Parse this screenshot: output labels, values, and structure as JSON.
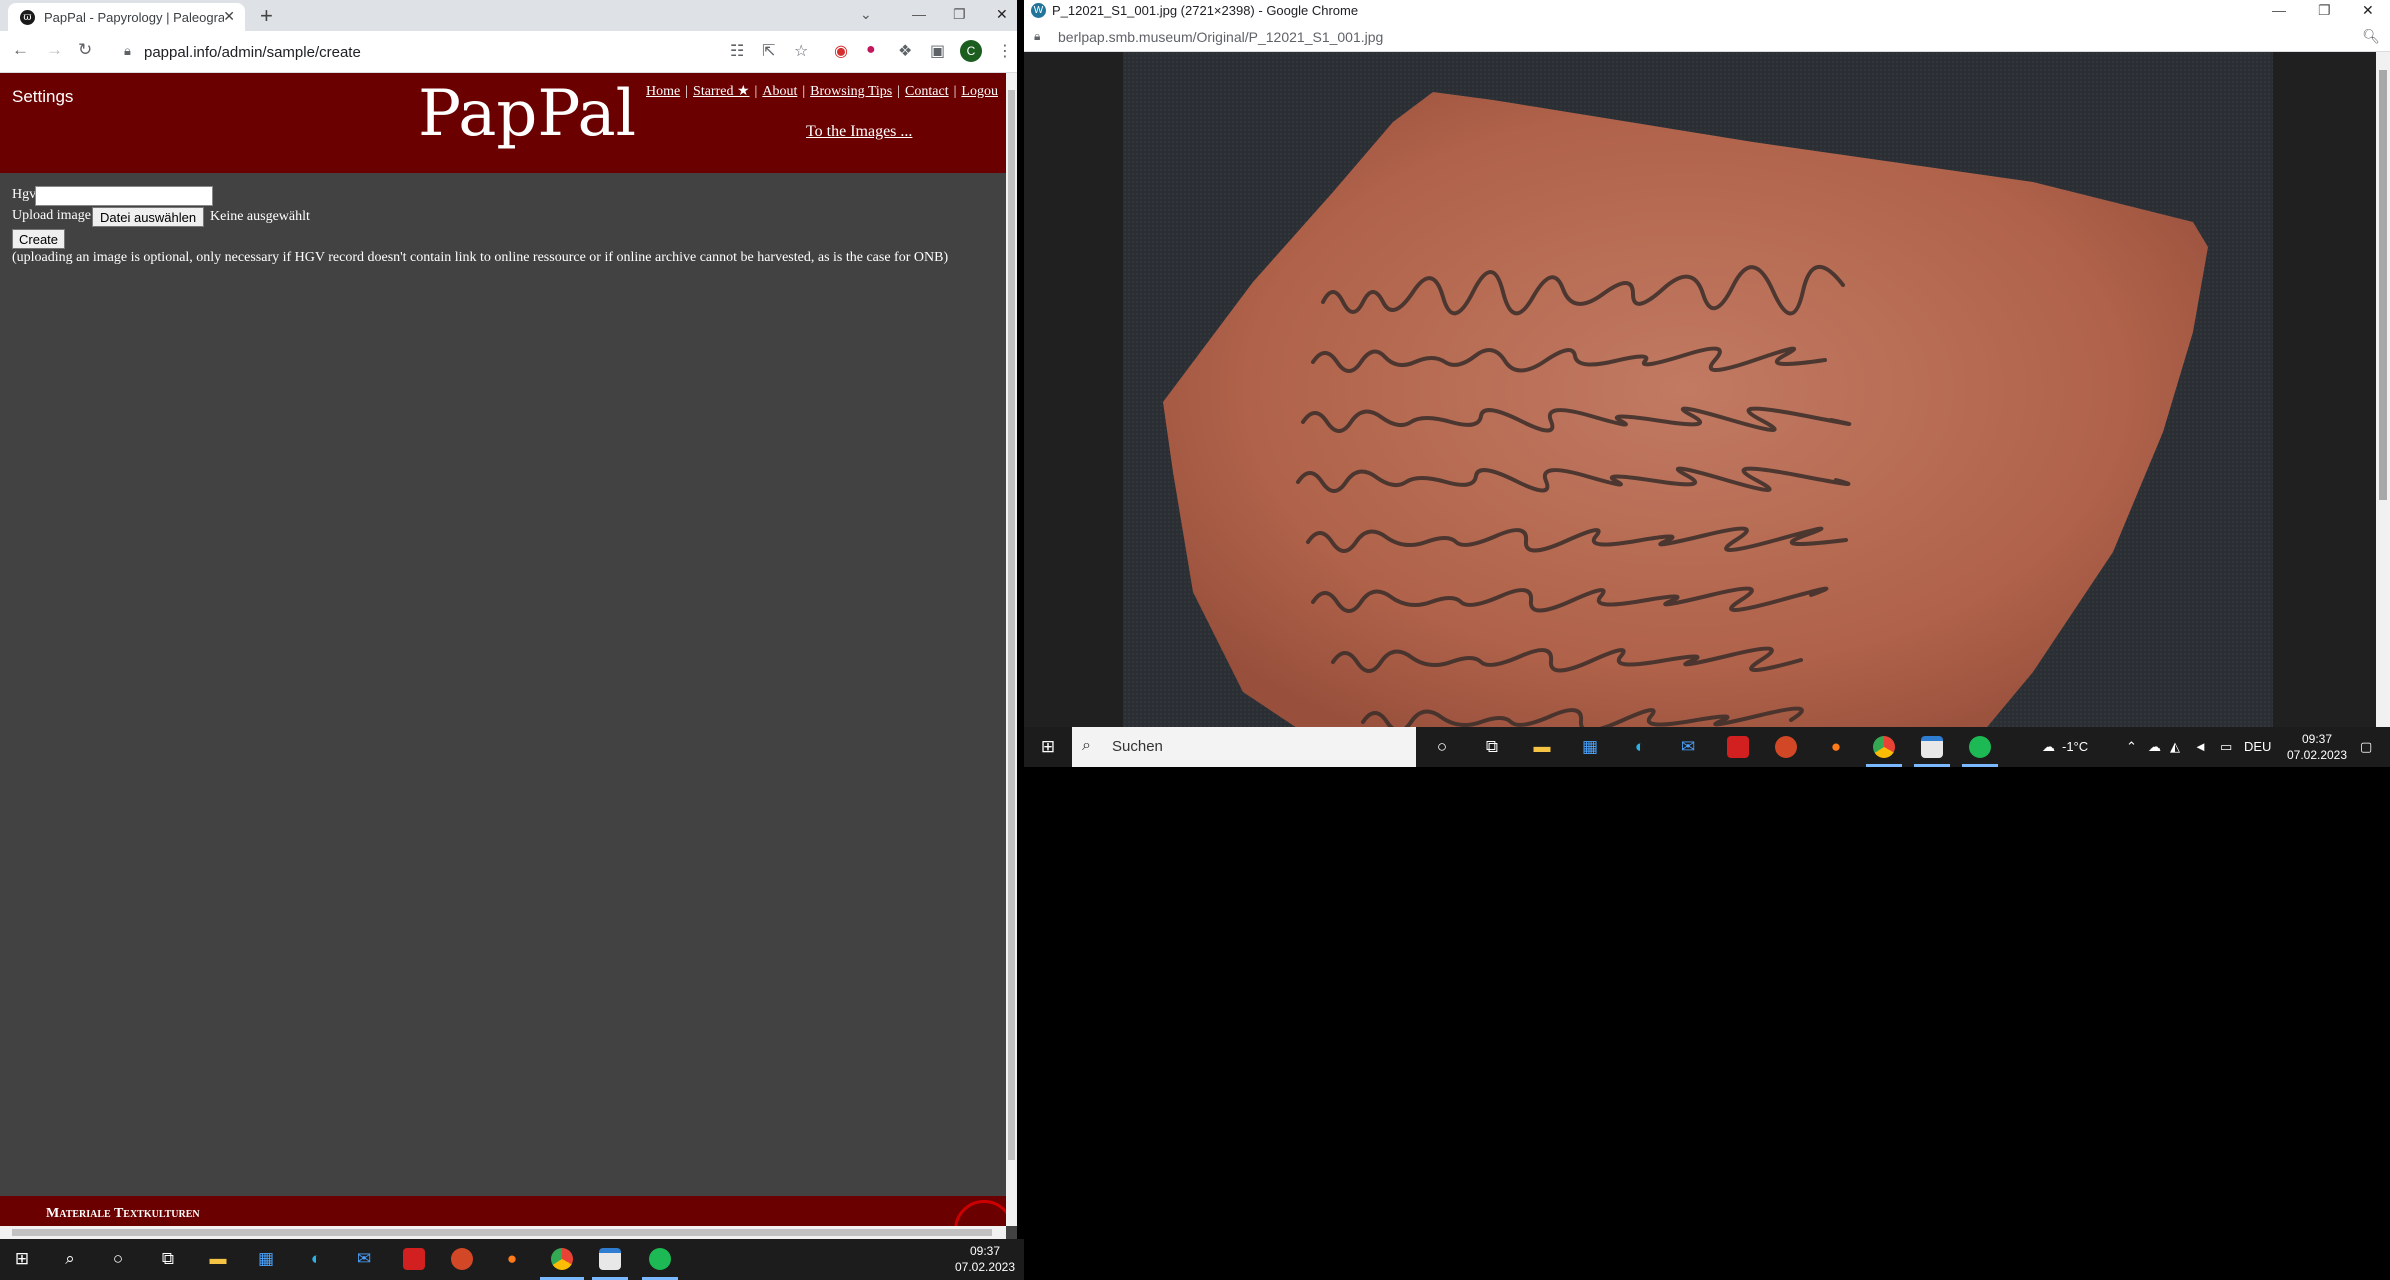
{
  "left_window": {
    "tab_title": "PapPal - Papyrology | Paleograph",
    "url": "pappal.info/admin/sample/create",
    "avatar_letter": "C",
    "site": {
      "settings_label": "Settings",
      "logo": "PapPal",
      "nav": [
        "Home",
        "Starred ★",
        "About",
        "Browsing Tips",
        "Contact",
        "Logou"
      ],
      "to_images": "To the Images ..."
    },
    "form": {
      "hgv_label": "Hgv",
      "hgv_value": "",
      "upload_label": "Upload image",
      "upload_button": "Datei auswählen",
      "upload_status": "Keine ausgewählt",
      "create_button": "Create",
      "note": "(uploading an image is optional, only necessary if HGV record doesn't contain link to online ressource or if online archive cannot be harvested, as is the case for ONB)"
    },
    "footer_text": "Materiale Textkulturen"
  },
  "right_window": {
    "title": "P_12021_S1_001.jpg (2721×2398) - Google Chrome",
    "url": "berlpap.smb.museum/Original/P_12021_S1_001.jpg"
  },
  "taskbar_right": {
    "search_placeholder": "Suchen",
    "weather": "-1°C",
    "lang": "DEU",
    "time": "09:37",
    "date": "07.02.2023"
  },
  "taskbar_left": {
    "time": "09:37",
    "date": "07.02.2023"
  },
  "colors": {
    "header_red": "#6b0000",
    "page_bg": "#424242",
    "sherd": "#b5634a"
  }
}
